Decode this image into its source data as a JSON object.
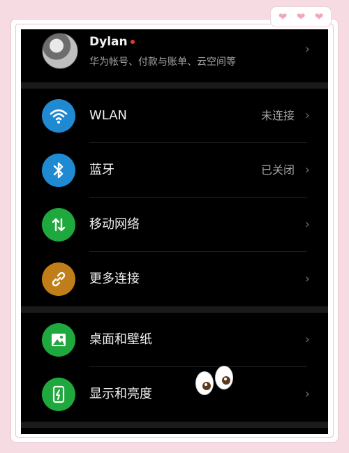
{
  "profile": {
    "name": "Dylan",
    "subtitle": "华为帐号、付款与账单、云空间等"
  },
  "sections": [
    [
      {
        "label": "WLAN",
        "status": "未连接",
        "icon": "wifi-icon",
        "color": "#1f8ad2"
      },
      {
        "label": "蓝牙",
        "status": "已关闭",
        "icon": "bluetooth-icon",
        "color": "#1f8ad2"
      },
      {
        "label": "移动网络",
        "status": "",
        "icon": "mobile-data-icon",
        "color": "#1ea83d"
      },
      {
        "label": "更多连接",
        "status": "",
        "icon": "link-icon",
        "color": "#c07d1a"
      }
    ],
    [
      {
        "label": "桌面和壁纸",
        "status": "",
        "icon": "wallpaper-icon",
        "color": "#1ea83d"
      },
      {
        "label": "显示和亮度",
        "status": "",
        "icon": "display-icon",
        "color": "#1ea83d"
      }
    ]
  ],
  "chevron": "›"
}
